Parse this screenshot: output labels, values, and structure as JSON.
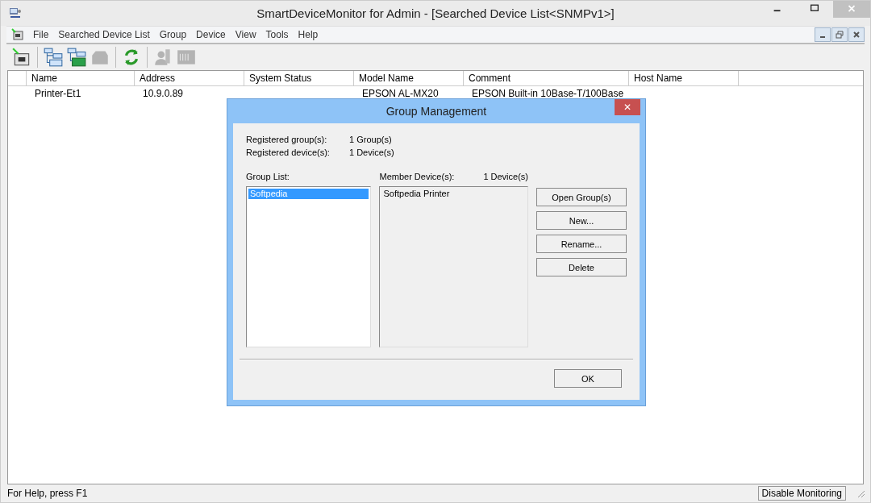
{
  "window": {
    "title": "SmartDeviceMonitor for Admin - [Searched Device List<SNMPv1>]"
  },
  "menu": [
    "File",
    "Searched Device List",
    "Group",
    "Device",
    "View",
    "Tools",
    "Help"
  ],
  "toolbar": [
    [
      {
        "kind": "printer",
        "disabled": false
      }
    ],
    [
      {
        "kind": "list",
        "disabled": false
      },
      {
        "kind": "list-green",
        "disabled": false
      },
      {
        "kind": "device",
        "disabled": true
      }
    ],
    [
      {
        "kind": "refresh",
        "disabled": false
      }
    ],
    [
      {
        "kind": "person",
        "disabled": true
      },
      {
        "kind": "panel",
        "disabled": true
      }
    ]
  ],
  "table": {
    "columns": [
      "Name",
      "Address",
      "System Status",
      "Model Name",
      "Comment",
      "Host Name"
    ],
    "rows": [
      {
        "name": "Printer-Et1",
        "address": "10.9.0.89",
        "model_name": "EPSON AL-MX20",
        "comment": "EPSON Built-in 10Base-T/100Base"
      }
    ]
  },
  "dialog": {
    "title": "Group Management",
    "close": "✕",
    "info": [
      {
        "label": "Registered group(s):",
        "value": "1 Group(s)"
      },
      {
        "label": "Registered device(s):",
        "value": "1 Device(s)"
      }
    ],
    "group_list": {
      "label": "Group List:",
      "items": [
        {
          "text": "Softpedia",
          "selected": true
        }
      ]
    },
    "members": {
      "label": "Member Device(s):",
      "count": "1 Device(s)",
      "items": [
        "Softpedia Printer"
      ]
    },
    "buttons": [
      "Open Group(s)",
      "New...",
      "Rename...",
      "Delete"
    ],
    "ok": "OK"
  },
  "status_bar": {
    "help": "For Help, press F1",
    "monitoring": "Disable Monitoring"
  }
}
